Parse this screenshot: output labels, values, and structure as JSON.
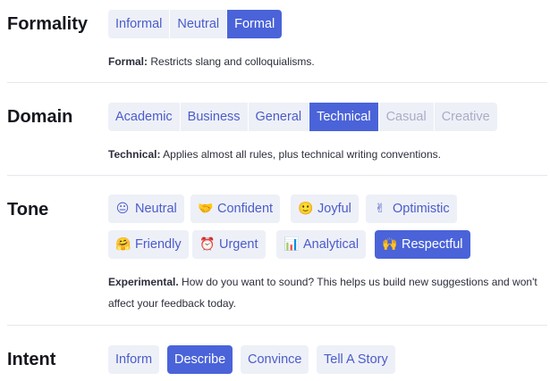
{
  "formality": {
    "heading": "Formality",
    "options": [
      "Informal",
      "Neutral",
      "Formal"
    ],
    "selected": "Formal",
    "desc_label": "Formal:",
    "desc_text": " Restricts slang and colloquialisms."
  },
  "domain": {
    "heading": "Domain",
    "options": [
      "Academic",
      "Business",
      "General",
      "Technical",
      "Casual",
      "Creative"
    ],
    "selected": "Technical",
    "disabled": [
      "Casual",
      "Creative"
    ],
    "desc_label": "Technical:",
    "desc_text": " Applies almost all rules, plus technical writing conventions."
  },
  "tone": {
    "heading": "Tone",
    "chips": [
      {
        "emoji": "😐",
        "label": "Neutral",
        "icon": "neutral-face-icon"
      },
      {
        "emoji": "🤝",
        "label": "Confident",
        "icon": "handshake-icon"
      },
      {
        "emoji": "🙂",
        "label": "Joyful",
        "icon": "smiling-face-icon"
      },
      {
        "emoji": "✌",
        "label": "Optimistic",
        "icon": "victory-hand-icon"
      },
      {
        "emoji": "🤗",
        "label": "Friendly",
        "icon": "hugging-face-icon"
      },
      {
        "emoji": "⏰",
        "label": "Urgent",
        "icon": "alarm-clock-icon"
      },
      {
        "emoji": "📊",
        "label": "Analytical",
        "icon": "bar-chart-icon"
      },
      {
        "emoji": "🙌",
        "label": "Respectful",
        "icon": "raised-hands-icon"
      }
    ],
    "selected": "Respectful",
    "desc_label": "Experimental.",
    "desc_text": " How do you want to sound? This helps us build new suggestions and won't affect your feedback today."
  },
  "intent": {
    "heading": "Intent",
    "options": [
      "Inform",
      "Describe",
      "Convince",
      "Tell A Story"
    ],
    "selected": "Describe"
  },
  "colors": {
    "accent": "#4a63d9",
    "chip_bg": "#eef0f8",
    "chip_text": "#4a5cc9",
    "disabled_text": "#a9adc4"
  }
}
